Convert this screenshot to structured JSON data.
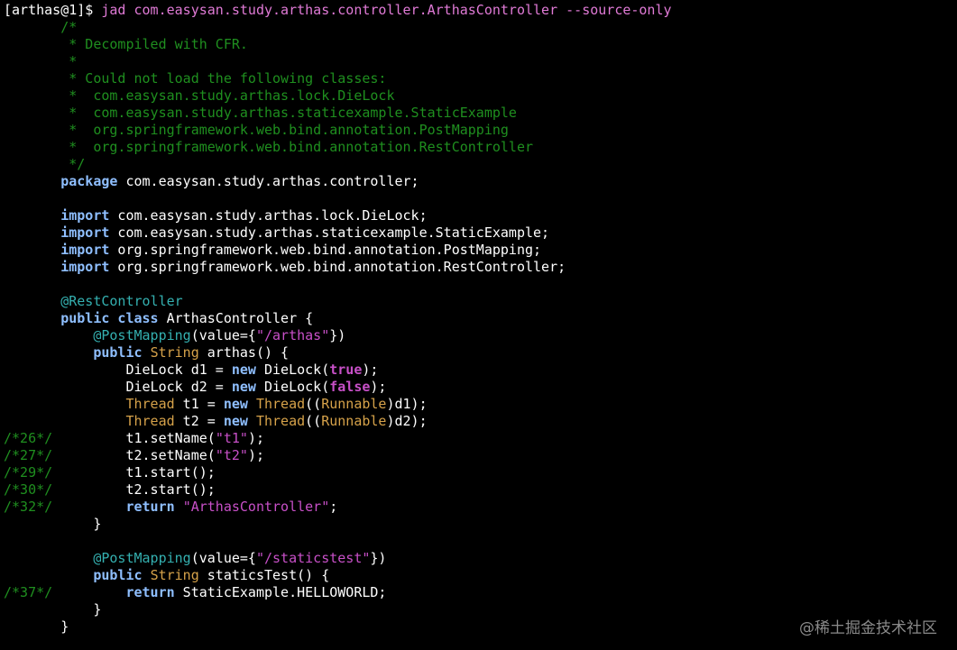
{
  "colors": {
    "background": "#000000",
    "prompt": "#ffffff",
    "command": "#e07ad6",
    "comment": "#1f8f1f",
    "keyword": "#8fbfff",
    "type": "#d6a24a",
    "annotation": "#34b0b0",
    "string": "#c850c8",
    "plain": "#ffffff"
  },
  "terminal": {
    "lines": [
      [
        {
          "t": "[arthas@1]$ ",
          "c": "prompt"
        },
        {
          "t": "jad com.easysan.study.arthas.controller.ArthasController --source-only",
          "c": "cmd"
        }
      ],
      [
        {
          "t": "       /*",
          "c": "comment"
        }
      ],
      [
        {
          "t": "        * Decompiled with CFR.",
          "c": "comment"
        }
      ],
      [
        {
          "t": "        *",
          "c": "comment"
        }
      ],
      [
        {
          "t": "        * Could not load the following classes:",
          "c": "comment"
        }
      ],
      [
        {
          "t": "        *  com.easysan.study.arthas.lock.DieLock",
          "c": "comment"
        }
      ],
      [
        {
          "t": "        *  com.easysan.study.arthas.staticexample.StaticExample",
          "c": "comment"
        }
      ],
      [
        {
          "t": "        *  org.springframework.web.bind.annotation.PostMapping",
          "c": "comment"
        }
      ],
      [
        {
          "t": "        *  org.springframework.web.bind.annotation.RestController",
          "c": "comment"
        }
      ],
      [
        {
          "t": "        */",
          "c": "comment"
        }
      ],
      [
        {
          "t": "       ",
          "c": "plain"
        },
        {
          "t": "package",
          "c": "keyword"
        },
        {
          "t": " com.easysan.study.arthas.controller;",
          "c": "plain"
        }
      ],
      [],
      [
        {
          "t": "       ",
          "c": "plain"
        },
        {
          "t": "import",
          "c": "keyword"
        },
        {
          "t": " com.easysan.study.arthas.lock.DieLock;",
          "c": "plain"
        }
      ],
      [
        {
          "t": "       ",
          "c": "plain"
        },
        {
          "t": "import",
          "c": "keyword"
        },
        {
          "t": " com.easysan.study.arthas.staticexample.StaticExample;",
          "c": "plain"
        }
      ],
      [
        {
          "t": "       ",
          "c": "plain"
        },
        {
          "t": "import",
          "c": "keyword"
        },
        {
          "t": " org.springframework.web.bind.annotation.PostMapping;",
          "c": "plain"
        }
      ],
      [
        {
          "t": "       ",
          "c": "plain"
        },
        {
          "t": "import",
          "c": "keyword"
        },
        {
          "t": " org.springframework.web.bind.annotation.RestController;",
          "c": "plain"
        }
      ],
      [],
      [
        {
          "t": "       ",
          "c": "plain"
        },
        {
          "t": "@RestController",
          "c": "annot"
        }
      ],
      [
        {
          "t": "       ",
          "c": "plain"
        },
        {
          "t": "public class",
          "c": "keyword"
        },
        {
          "t": " ArthasController {",
          "c": "plain"
        }
      ],
      [
        {
          "t": "           ",
          "c": "plain"
        },
        {
          "t": "@PostMapping",
          "c": "annot"
        },
        {
          "t": "(value={",
          "c": "plain"
        },
        {
          "t": "\"/arthas\"",
          "c": "string"
        },
        {
          "t": "})",
          "c": "plain"
        }
      ],
      [
        {
          "t": "           ",
          "c": "plain"
        },
        {
          "t": "public",
          "c": "keyword"
        },
        {
          "t": " ",
          "c": "plain"
        },
        {
          "t": "String",
          "c": "type"
        },
        {
          "t": " arthas() {",
          "c": "plain"
        }
      ],
      [
        {
          "t": "               DieLock d1 = ",
          "c": "plain"
        },
        {
          "t": "new",
          "c": "keyword"
        },
        {
          "t": " DieLock(",
          "c": "plain"
        },
        {
          "t": "true",
          "c": "literal"
        },
        {
          "t": ");",
          "c": "plain"
        }
      ],
      [
        {
          "t": "               DieLock d2 = ",
          "c": "plain"
        },
        {
          "t": "new",
          "c": "keyword"
        },
        {
          "t": " DieLock(",
          "c": "plain"
        },
        {
          "t": "false",
          "c": "literal"
        },
        {
          "t": ");",
          "c": "plain"
        }
      ],
      [
        {
          "t": "               ",
          "c": "plain"
        },
        {
          "t": "Thread",
          "c": "type"
        },
        {
          "t": " t1 = ",
          "c": "plain"
        },
        {
          "t": "new",
          "c": "keyword"
        },
        {
          "t": " ",
          "c": "plain"
        },
        {
          "t": "Thread",
          "c": "type"
        },
        {
          "t": "((",
          "c": "plain"
        },
        {
          "t": "Runnable",
          "c": "type"
        },
        {
          "t": ")d1);",
          "c": "plain"
        }
      ],
      [
        {
          "t": "               ",
          "c": "plain"
        },
        {
          "t": "Thread",
          "c": "type"
        },
        {
          "t": " t2 = ",
          "c": "plain"
        },
        {
          "t": "new",
          "c": "keyword"
        },
        {
          "t": " ",
          "c": "plain"
        },
        {
          "t": "Thread",
          "c": "type"
        },
        {
          "t": "((",
          "c": "plain"
        },
        {
          "t": "Runnable",
          "c": "type"
        },
        {
          "t": ")d2);",
          "c": "plain"
        }
      ],
      [
        {
          "t": "/*26*/",
          "c": "linenum"
        },
        {
          "t": "         t1.setName(",
          "c": "plain"
        },
        {
          "t": "\"t1\"",
          "c": "string"
        },
        {
          "t": ");",
          "c": "plain"
        }
      ],
      [
        {
          "t": "/*27*/",
          "c": "linenum"
        },
        {
          "t": "         t2.setName(",
          "c": "plain"
        },
        {
          "t": "\"t2\"",
          "c": "string"
        },
        {
          "t": ");",
          "c": "plain"
        }
      ],
      [
        {
          "t": "/*29*/",
          "c": "linenum"
        },
        {
          "t": "         t1.start();",
          "c": "plain"
        }
      ],
      [
        {
          "t": "/*30*/",
          "c": "linenum"
        },
        {
          "t": "         t2.start();",
          "c": "plain"
        }
      ],
      [
        {
          "t": "/*32*/",
          "c": "linenum"
        },
        {
          "t": "         ",
          "c": "plain"
        },
        {
          "t": "return",
          "c": "keyword"
        },
        {
          "t": " ",
          "c": "plain"
        },
        {
          "t": "\"ArthasController\"",
          "c": "string"
        },
        {
          "t": ";",
          "c": "plain"
        }
      ],
      [
        {
          "t": "           }",
          "c": "plain"
        }
      ],
      [],
      [
        {
          "t": "           ",
          "c": "plain"
        },
        {
          "t": "@PostMapping",
          "c": "annot"
        },
        {
          "t": "(value={",
          "c": "plain"
        },
        {
          "t": "\"/staticstest\"",
          "c": "string"
        },
        {
          "t": "})",
          "c": "plain"
        }
      ],
      [
        {
          "t": "           ",
          "c": "plain"
        },
        {
          "t": "public",
          "c": "keyword"
        },
        {
          "t": " ",
          "c": "plain"
        },
        {
          "t": "String",
          "c": "type"
        },
        {
          "t": " staticsTest() {",
          "c": "plain"
        }
      ],
      [
        {
          "t": "/*37*/",
          "c": "linenum"
        },
        {
          "t": "         ",
          "c": "plain"
        },
        {
          "t": "return",
          "c": "keyword"
        },
        {
          "t": " StaticExample.HELLOWORLD;",
          "c": "plain"
        }
      ],
      [
        {
          "t": "           }",
          "c": "plain"
        }
      ],
      [
        {
          "t": "       }",
          "c": "plain"
        }
      ]
    ]
  },
  "watermark": {
    "text": "@稀土掘金技术社区"
  }
}
